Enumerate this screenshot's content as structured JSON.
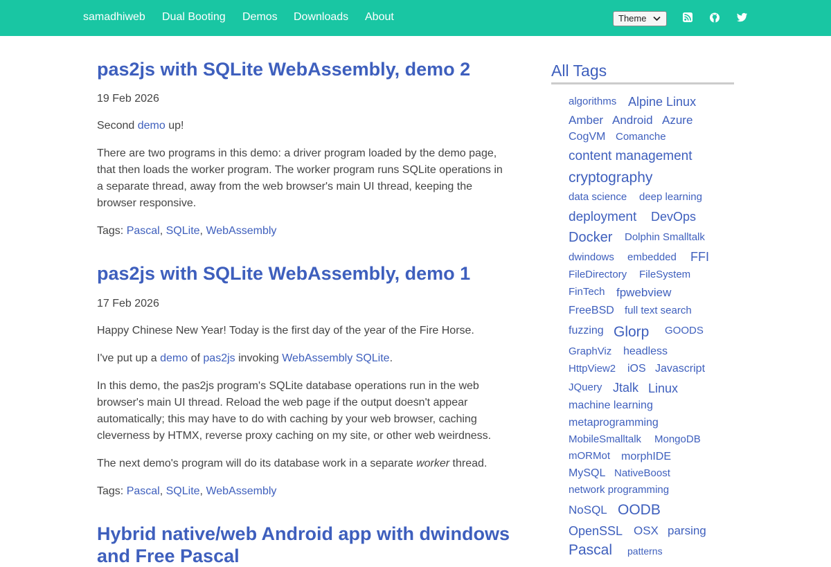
{
  "nav": {
    "brand": "samadhiweb",
    "links": [
      "Dual Booting",
      "Demos",
      "Downloads",
      "About"
    ],
    "theme_label": "Theme",
    "icons": [
      "rss-icon",
      "github-icon",
      "twitter-icon"
    ]
  },
  "colors": {
    "navbar": "#19c6a3",
    "link": "#3e5fbd",
    "text": "#444444"
  },
  "posts": [
    {
      "title": "pas2js with SQLite WebAssembly, demo 2",
      "date": "19 Feb 2026",
      "p1": {
        "before": "Second ",
        "link": "demo",
        "after": " up!"
      },
      "p2": "There are two programs in this demo: a driver program loaded by the demo page, that then loads the worker program. The worker program runs SQLite operations in a separate thread, away from the web browser's main UI thread, keeping the browser responsive.",
      "tags_label": "Tags:",
      "tags": [
        "Pascal",
        "SQLite",
        "WebAssembly"
      ]
    },
    {
      "title": "pas2js with SQLite WebAssembly, demo 1",
      "date": "17 Feb 2026",
      "p1": "Happy Chinese New Year! Today is the first day of the year of the Fire Horse.",
      "p2": {
        "t1": "I've put up a ",
        "l1": "demo",
        "t2": " of ",
        "l2": "pas2js",
        "t3": " invoking ",
        "l3": "WebAssembly SQLite",
        "t4": "."
      },
      "p3": "In this demo, the pas2js program's SQLite database operations run in the web browser's main UI thread. Reload the web page if the output doesn't appear automatically; this may have to do with caching by your web browser, caching cleverness by HTMX, reverse proxy caching on my site, or other web weirdness.",
      "p4": {
        "before": "The next demo's program will do its database work in a separate ",
        "em": "worker",
        "after": " thread."
      },
      "tags_label": "Tags:",
      "tags": [
        "Pascal",
        "SQLite",
        "WebAssembly"
      ]
    },
    {
      "title": "Hybrid native/web Android app with dwindows and Free Pascal"
    }
  ],
  "sidebar": {
    "title": "All Tags",
    "tags": [
      "algorithms",
      "Alpine Linux",
      "Amber",
      "Android",
      "Azure",
      "CogVM",
      "Comanche",
      "content management",
      "cryptography",
      "data science",
      "deep learning",
      "deployment",
      "DevOps",
      "Docker",
      "Dolphin Smalltalk",
      "dwindows",
      "embedded",
      "FFI",
      "FileDirectory",
      "FileSystem",
      "FinTech",
      "fpwebview",
      "FreeBSD",
      "full text search",
      "fuzzing",
      "Glorp",
      "GOODS",
      "GraphViz",
      "headless",
      "HttpView2",
      "iOS",
      "Javascript",
      "JQuery",
      "Jtalk",
      "Linux",
      "machine learning",
      "metaprogramming",
      "MobileSmalltalk",
      "MongoDB",
      "mORMot",
      "morphIDE",
      "MySQL",
      "NativeBoost",
      "network programming",
      "NoSQL",
      "OODB",
      "OpenSSL",
      "OSX",
      "parsing",
      "Pascal",
      "patterns"
    ]
  }
}
